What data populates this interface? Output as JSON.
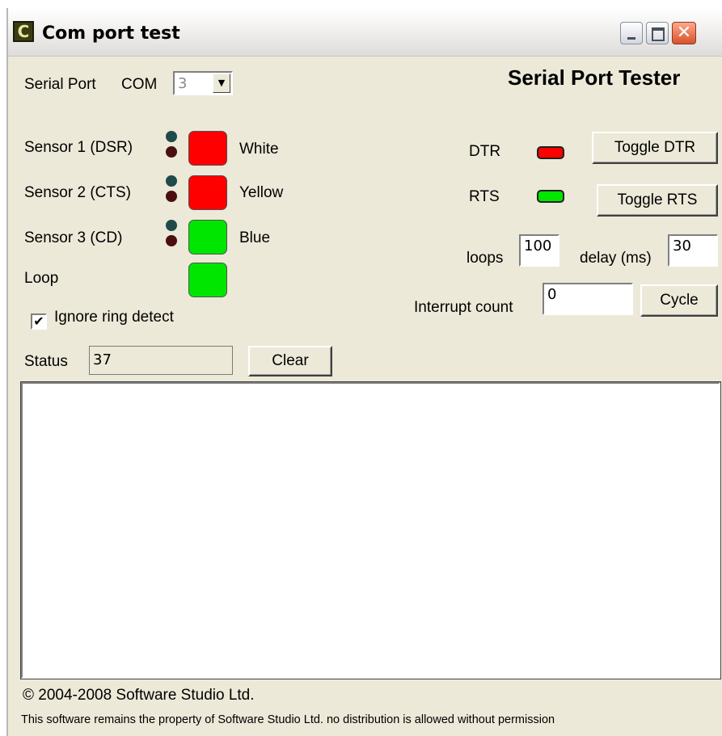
{
  "window": {
    "title": "Com port test",
    "app_icon_letter": "C",
    "close_glyph": "✕"
  },
  "header": {
    "title": "Serial Port Tester"
  },
  "serial": {
    "label": "Serial Port",
    "com_label": "COM",
    "selected": "3"
  },
  "sensors": [
    {
      "label": "Sensor 1 (DSR)",
      "color_name": "White",
      "state_color": "#ff0000"
    },
    {
      "label": "Sensor 2 (CTS)",
      "color_name": "Yellow",
      "state_color": "#ff0000"
    },
    {
      "label": "Sensor 3 (CD)",
      "color_name": "Blue",
      "state_color": "#00e600"
    }
  ],
  "loop": {
    "label": "Loop",
    "state_color": "#00e600"
  },
  "ignore_ring": {
    "label": "Ignore ring detect",
    "checked": true
  },
  "status": {
    "label": "Status",
    "value": "37",
    "clear_label": "Clear"
  },
  "dtr": {
    "label": "DTR",
    "state_color": "#ff0000",
    "button": "Toggle DTR"
  },
  "rts": {
    "label": "RTS",
    "state_color": "#00e600",
    "button": "Toggle RTS"
  },
  "loops": {
    "label": "loops",
    "value": "100"
  },
  "delay": {
    "label": "delay (ms)",
    "value": "30"
  },
  "interrupt": {
    "label": "Interrupt count",
    "value": "0",
    "cycle_label": "Cycle"
  },
  "footer": {
    "copyright": "© 2004-2008 Software Studio Ltd.",
    "notice": "This software remains the property of Software Studio Ltd. no distribution is allowed without permission"
  }
}
